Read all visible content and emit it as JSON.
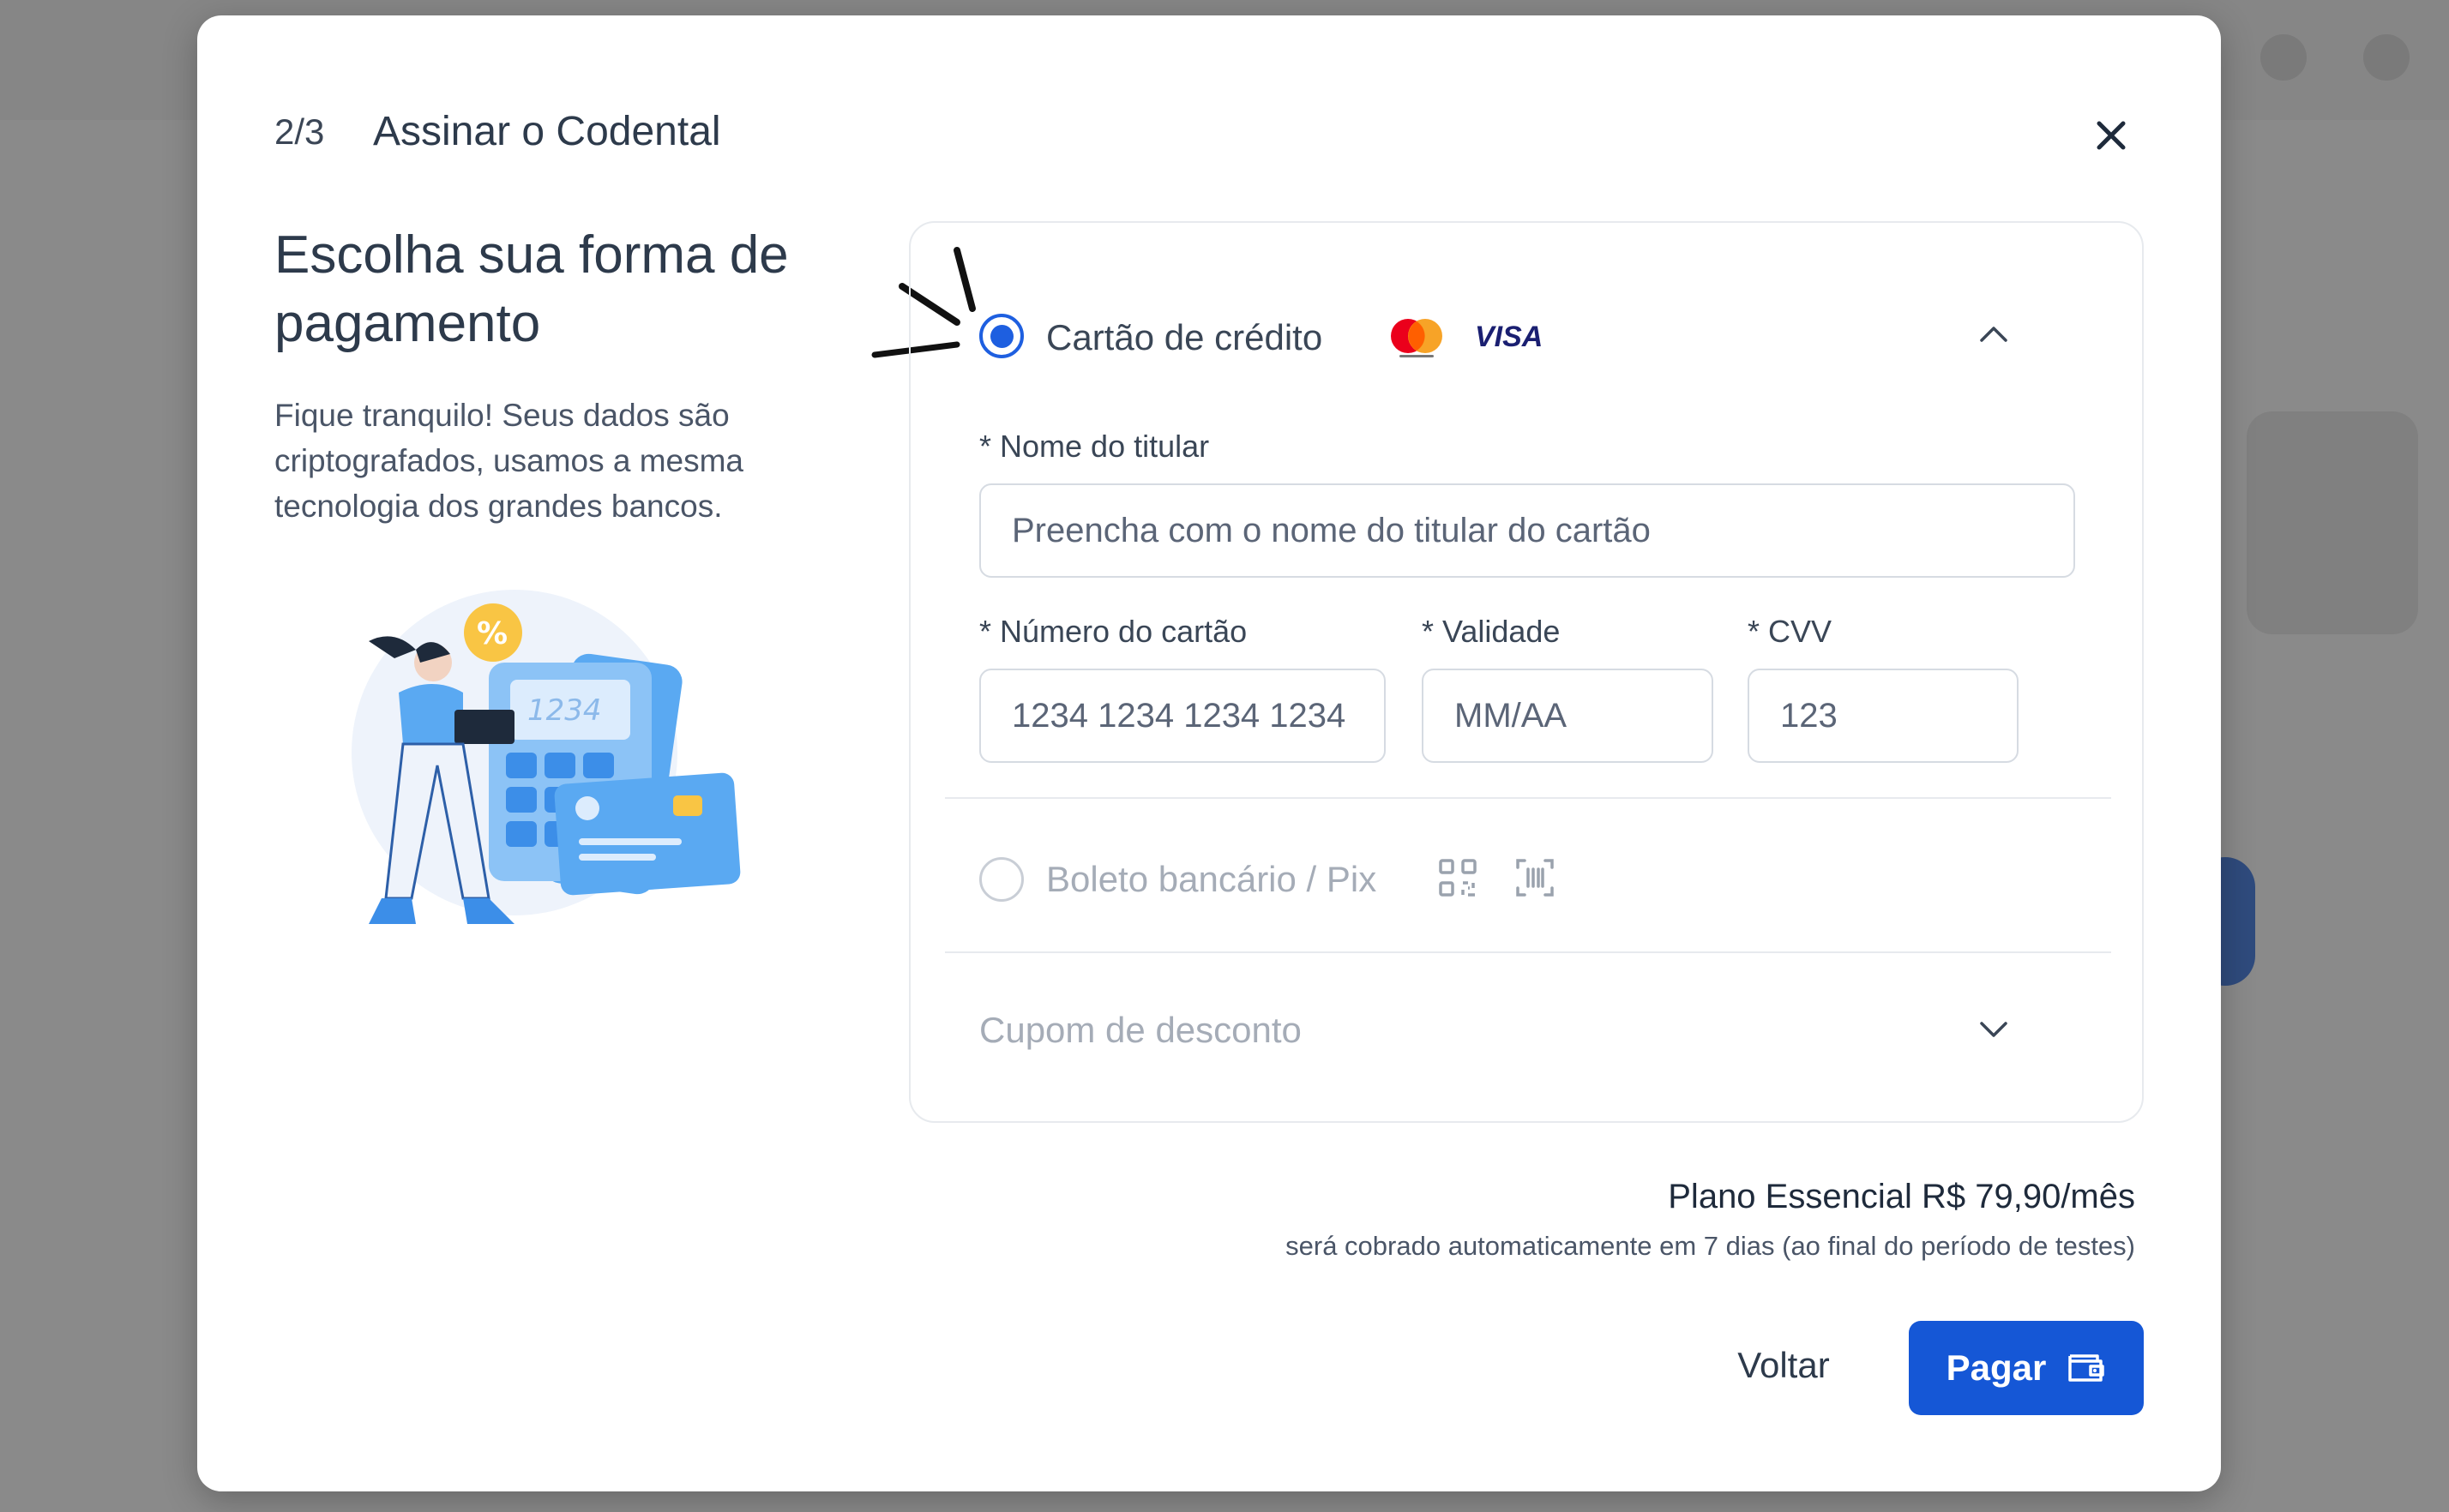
{
  "modal": {
    "step": "2/3",
    "title": "Assinar o Codental"
  },
  "left": {
    "heading": "Escolha sua forma de pagamento",
    "description": "Fique tranquilo! Seus dados são criptografados, usamos a mesma tecnologia dos grandes bancos.",
    "illustration_text": "1234"
  },
  "payment": {
    "credit_card": {
      "label": "Cartão de crédito",
      "selected": true,
      "brands": [
        "mastercard-icon",
        "VISA"
      ]
    },
    "holder": {
      "label": "* Nome do titular",
      "placeholder": "Preencha com o nome do titular do cartão"
    },
    "card_number": {
      "label": "* Número do cartão",
      "placeholder": "1234 1234 1234 1234"
    },
    "expiry": {
      "label": "* Validade",
      "placeholder": "MM/AA"
    },
    "cvv": {
      "label": "* CVV",
      "placeholder": "123"
    },
    "boleto": {
      "label": "Boleto bancário / Pix",
      "selected": false
    },
    "coupon": {
      "label": "Cupom de desconto"
    }
  },
  "summary": {
    "plan": "Plano Essencial R$ 79,90/mês",
    "note": "será cobrado automaticamente em 7 dias (ao final do período de testes)"
  },
  "actions": {
    "back": "Voltar",
    "pay": "Pagar"
  },
  "colors": {
    "primary": "#1557d6",
    "radio_selected": "#1e5fe0",
    "illustration_blue": "#5aa9f2",
    "accent_yellow": "#f9c544"
  }
}
